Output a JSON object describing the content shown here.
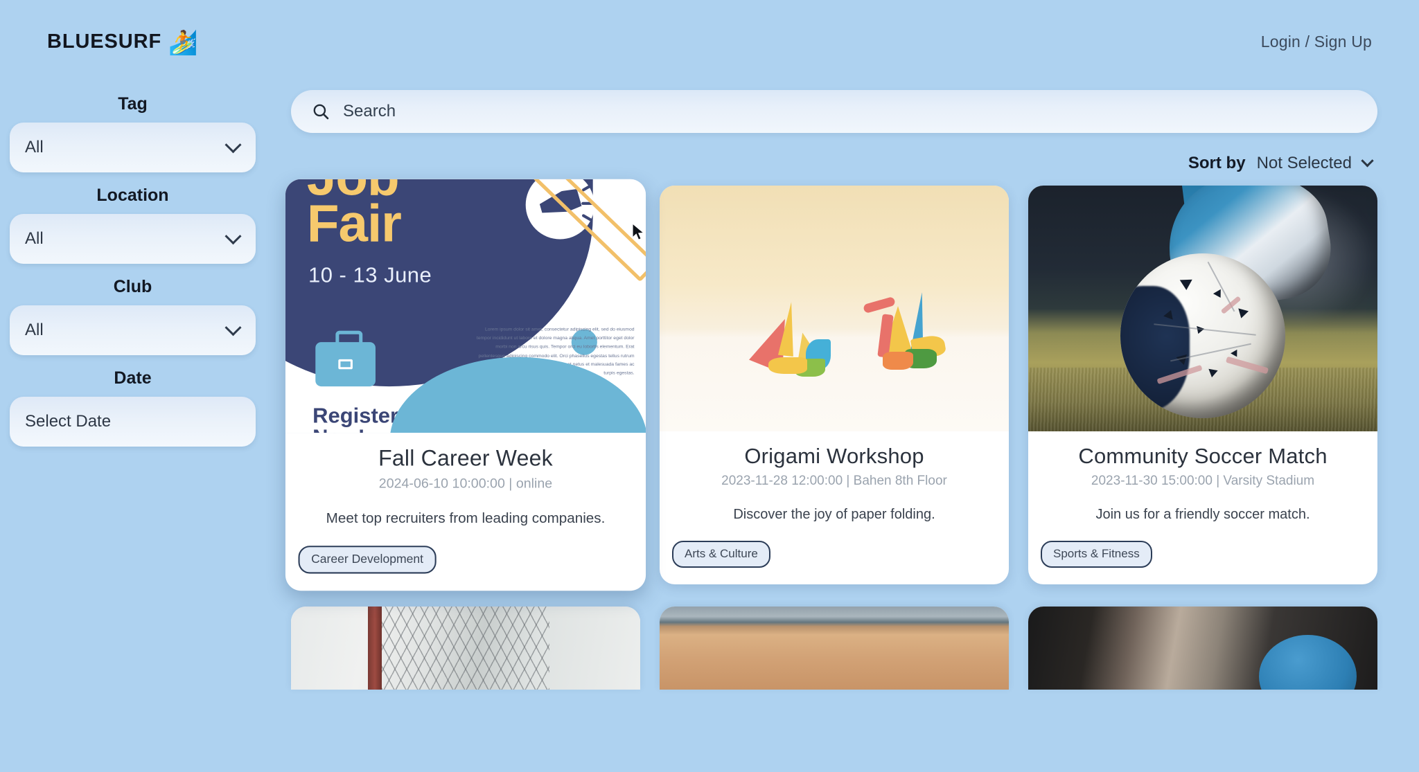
{
  "header": {
    "brand_name": "BLUESURF",
    "brand_emoji": "🏄",
    "auth_label": "Login / Sign Up"
  },
  "sidebar": {
    "filters": [
      {
        "label": "Tag",
        "value": "All",
        "icon": "chevron-down-icon"
      },
      {
        "label": "Location",
        "value": "All",
        "icon": "chevron-down-icon"
      },
      {
        "label": "Club",
        "value": "All",
        "icon": "chevron-down-icon"
      }
    ],
    "date_filter": {
      "label": "Date",
      "placeholder": "Select Date"
    }
  },
  "search": {
    "placeholder": "Search",
    "icon": "search-icon"
  },
  "sort": {
    "label": "Sort by",
    "value": "Not Selected",
    "icon": "chevron-down-icon"
  },
  "events": [
    {
      "title": "Fall Career Week",
      "meta": "2024-06-10 10:00:00 | online",
      "description": "Meet top recruiters from leading companies.",
      "tag": "Career Development",
      "image_name": "job-fair-poster",
      "poster": {
        "title_line1": "Job",
        "title_line2": "Fair",
        "dates": "10 - 13 June",
        "cta_line1": "Register",
        "cta_line2": "Now!",
        "body_text": "Lorem ipsum dolor sit amet, consectetur adipiscing elit, sed do eiusmod tempor incididunt ut labore et dolore magna aliqua. Amet porttitor eget dolor morbi non arcu risus quis. Tempor orci eu lobortis elementum. Erat pellentesque adipiscing commodo elit. Orci phasellus egestas tellus rutrum tellus pellentesque eu. Tristique senectus et netus et malesuada fames ac turpis egestas.",
        "colors": {
          "navy": "#3b4676",
          "yellow": "#f6c96d",
          "blue": "#6cb6d6"
        }
      }
    },
    {
      "title": "Origami Workshop",
      "meta": "2023-11-28 12:00:00 | Bahen 8th Floor",
      "description": "Discover the joy of paper folding.",
      "tag": "Arts & Culture",
      "image_name": "origami-cranes-photo"
    },
    {
      "title": "Community Soccer Match",
      "meta": "2023-11-30 15:00:00 | Varsity Stadium",
      "description": "Join us for a friendly soccer match.",
      "tag": "Sports & Fitness",
      "image_name": "soccer-ball-cleat-photo"
    }
  ],
  "events_next_row": [
    {
      "image_name": "tennis-net-photo"
    },
    {
      "image_name": "gym-floor-photo"
    },
    {
      "image_name": "skateboard-photo"
    }
  ],
  "colors": {
    "page_background": "#aed2f0",
    "card_background": "#ffffff",
    "tag_border": "#2c3d58",
    "tag_fill": "#e4ecf7",
    "text_primary": "#2b323d",
    "text_muted": "#9aa3ae"
  }
}
